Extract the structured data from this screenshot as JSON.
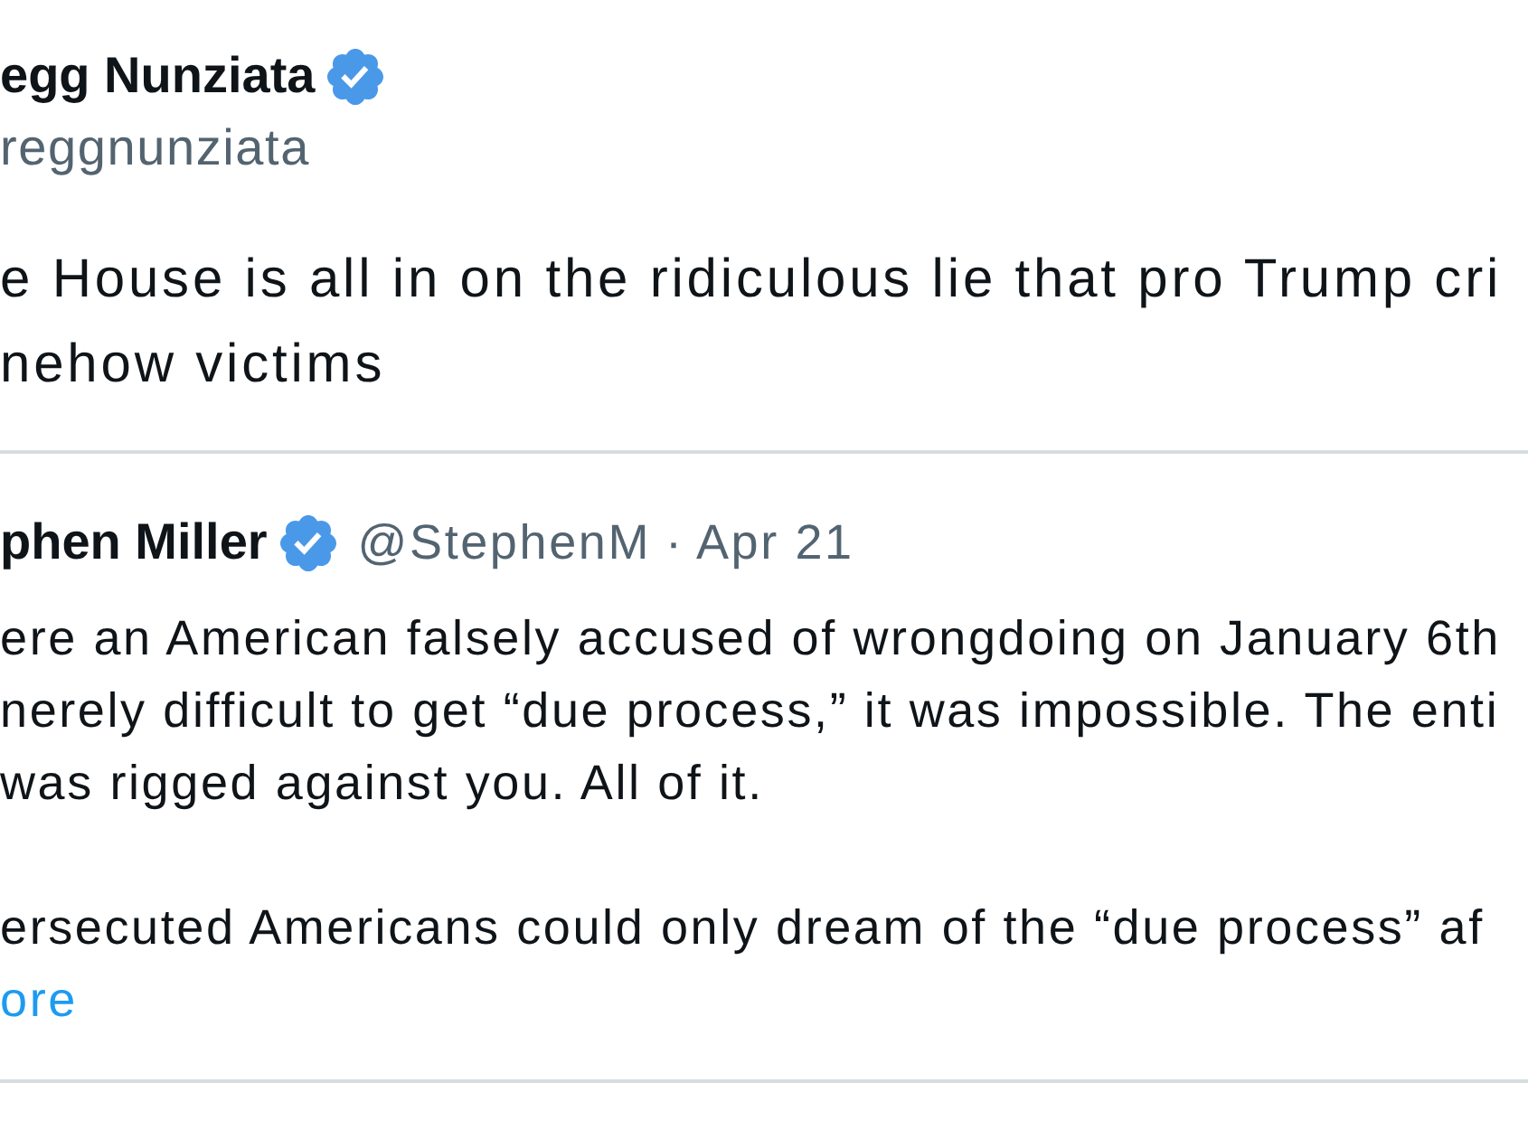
{
  "author": {
    "name": "egg Nunziata",
    "verified": true,
    "handle": "reggnunziata"
  },
  "text_lines": [
    "e House is all in on the ridiculous lie that pro Trump cri",
    "nehow victims"
  ],
  "quoted_tweet": {
    "author": {
      "name": "phen Miller",
      "verified": true,
      "handle": "@StephenM"
    },
    "separator": "·",
    "date": "Apr 21",
    "paragraphs": [
      [
        "ere an American falsely accused of wrongdoing on January 6th",
        "nerely difficult to get “due process,” it was impossible. The enti",
        "was rigged against you. All of it."
      ],
      [
        "ersecuted Americans could only dream of the “due process” af"
      ]
    ],
    "show_more": "ore"
  }
}
